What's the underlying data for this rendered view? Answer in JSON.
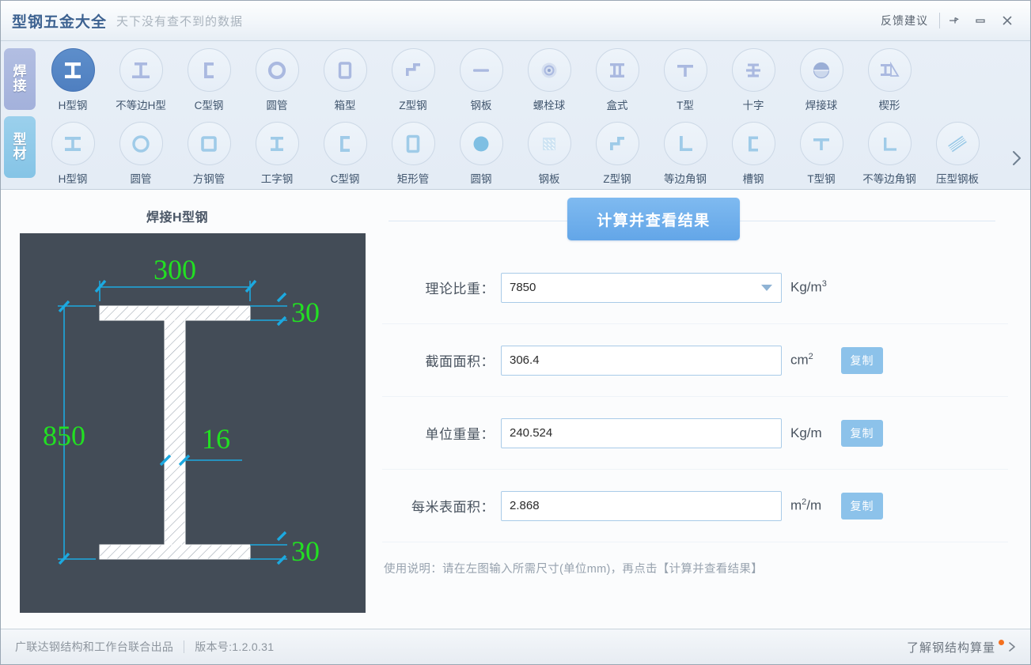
{
  "titlebar": {
    "app_title": "型钢五金大全",
    "slogan": "天下没有查不到的数据",
    "feedback": "反馈建议",
    "pin_icon": "pin-icon",
    "minimize_icon": "minimize-icon",
    "close_icon": "close-icon"
  },
  "toolbar": {
    "side_tabs": [
      {
        "label": "焊接",
        "char1": "焊",
        "char2": "接",
        "active": true
      },
      {
        "label": "型材",
        "char1": "型",
        "char2": "材",
        "active": false
      }
    ],
    "next_icon": "chevron-right-icon",
    "row1": [
      {
        "label": "H型钢",
        "icon": "h-beam-icon",
        "active": true
      },
      {
        "label": "不等边H型",
        "icon": "unequal-h-beam-icon",
        "active": false
      },
      {
        "label": "C型钢",
        "icon": "c-channel-icon",
        "active": false
      },
      {
        "label": "圆管",
        "icon": "round-pipe-icon",
        "active": false
      },
      {
        "label": "箱型",
        "icon": "box-section-icon",
        "active": false
      },
      {
        "label": "Z型钢",
        "icon": "z-section-icon",
        "active": false
      },
      {
        "label": "钢板",
        "icon": "steel-plate-icon",
        "active": false
      },
      {
        "label": "螺栓球",
        "icon": "bolt-ball-icon",
        "active": false
      },
      {
        "label": "盒式",
        "icon": "box-type-icon",
        "active": false
      },
      {
        "label": "T型",
        "icon": "t-section-icon",
        "active": false
      },
      {
        "label": "十字",
        "icon": "cross-section-icon",
        "active": false
      },
      {
        "label": "焊接球",
        "icon": "welded-ball-icon",
        "active": false
      },
      {
        "label": "楔形",
        "icon": "wedge-icon",
        "active": false
      }
    ],
    "row2": [
      {
        "label": "H型钢",
        "icon": "h-beam-icon",
        "active": false
      },
      {
        "label": "圆管",
        "icon": "round-pipe-icon",
        "active": false
      },
      {
        "label": "方钢管",
        "icon": "square-tube-icon",
        "active": false
      },
      {
        "label": "工字钢",
        "icon": "i-beam-icon",
        "active": false
      },
      {
        "label": "C型钢",
        "icon": "c-channel-icon",
        "active": false
      },
      {
        "label": "矩形管",
        "icon": "rect-tube-icon",
        "active": false
      },
      {
        "label": "圆钢",
        "icon": "round-bar-icon",
        "active": false
      },
      {
        "label": "钢板",
        "icon": "checkered-plate-icon",
        "active": false
      },
      {
        "label": "Z型钢",
        "icon": "z-section-icon",
        "active": false
      },
      {
        "label": "等边角钢",
        "icon": "equal-angle-icon",
        "active": false
      },
      {
        "label": "槽钢",
        "icon": "channel-steel-icon",
        "active": false
      },
      {
        "label": "T型钢",
        "icon": "t-steel-icon",
        "active": false
      },
      {
        "label": "不等边角钢",
        "icon": "unequal-angle-icon",
        "active": false
      },
      {
        "label": "压型钢板",
        "icon": "profiled-sheet-icon",
        "active": false
      }
    ]
  },
  "main": {
    "section_title": "焊接H型钢",
    "diagram": {
      "width": "300",
      "height": "850",
      "flange_top": "30",
      "flange_bottom": "30",
      "web": "16",
      "bg_color": "#434c57",
      "dim_text_color": "#22e022",
      "dim_line_color": "#1ca9e0",
      "section_fill": "#ffffff"
    },
    "calc_button": "计算并查看结果",
    "fields": [
      {
        "label": "理论比重：",
        "value": "7850",
        "unit_main": "Kg/m",
        "unit_sup": "3",
        "has_dropdown": true,
        "has_copy": false,
        "copy_label": "",
        "name": "theoretical-density"
      },
      {
        "label": "截面面积：",
        "value": "306.4",
        "unit_main": "cm",
        "unit_sup": "2",
        "has_dropdown": false,
        "has_copy": true,
        "copy_label": "复制",
        "name": "section-area"
      },
      {
        "label": "单位重量：",
        "value": "240.524",
        "unit_main": "Kg/m",
        "unit_sup": "",
        "has_dropdown": false,
        "has_copy": true,
        "copy_label": "复制",
        "name": "unit-weight"
      },
      {
        "label": "每米表面积：",
        "value": "2.868",
        "unit_main_pre": "m",
        "unit_sup": "2",
        "unit_main_post": "/m",
        "has_dropdown": false,
        "has_copy": true,
        "copy_label": "复制",
        "name": "surface-area-per-meter"
      }
    ],
    "usage_hint": "使用说明：请在左图输入所需尺寸(单位mm)，再点击【计算并查看结果】"
  },
  "statusbar": {
    "publisher": "广联达钢结构和工作台联合出品",
    "version": "版本号:1.2.0.31",
    "link": "了解钢结构算量",
    "chevron_icon": "chevron-right-icon",
    "badge_color": "#f4701f"
  }
}
